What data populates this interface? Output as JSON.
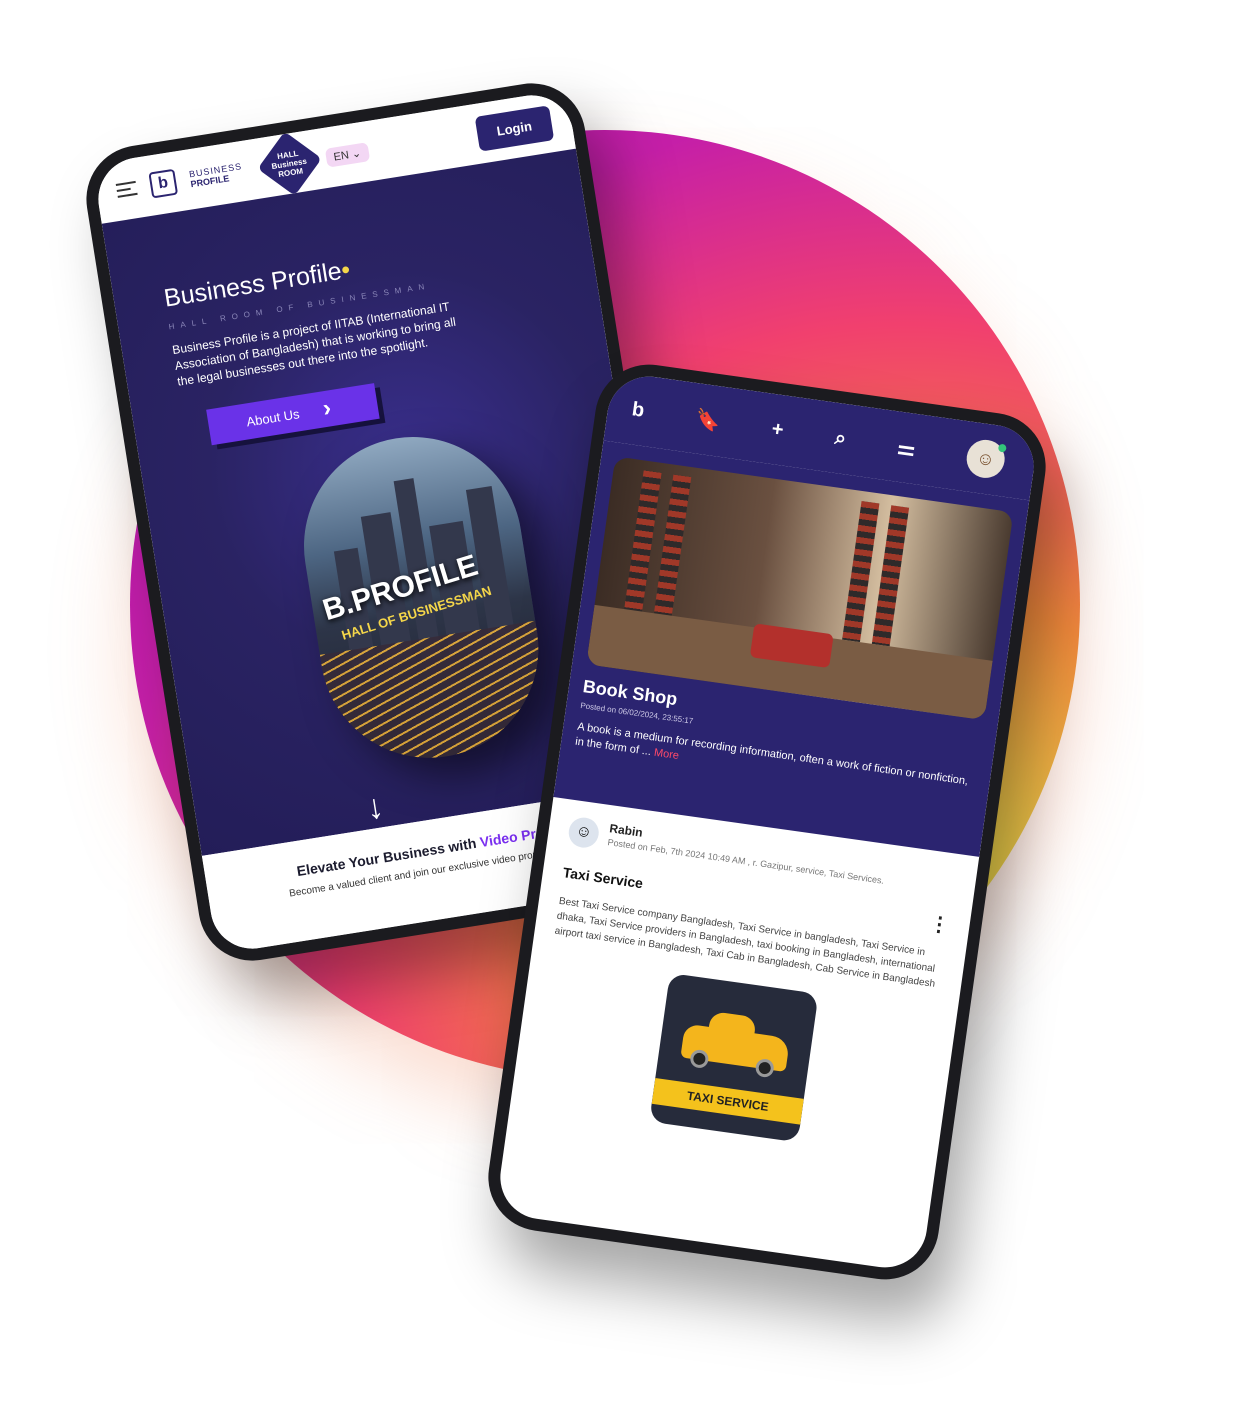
{
  "phone1": {
    "brand_short": "b",
    "brand_line1": "BUSINESS",
    "brand_line2": "PROFILE",
    "hall_badge": "HALL\nBusiness\nROOM",
    "lang": "EN",
    "login_label": "Login",
    "hero": {
      "title": "Business Profile",
      "subtitle": "HALL ROOM OF BUSINESSMAN",
      "description": "Business Profile is a project of IITAB (International IT Association of Bangladesh) that is working to bring all the legal businesses out there into the spotlight.",
      "about_label": "About Us",
      "pill_title": "B.PROFILE",
      "pill_subtitle": "HALL OF BUSINESSMAN"
    },
    "promo": {
      "title_prefix": "Elevate Your Business with ",
      "title_highlight": "Video Promotion",
      "description": "Become a valued client and join our exclusive video promotion program."
    }
  },
  "phone2": {
    "nav_icons": [
      "brand-b-icon",
      "bookmark-icon",
      "plus-icon",
      "search-icon",
      "filter-sliders-icon",
      "avatar"
    ],
    "card": {
      "title": "Book Shop",
      "date": "Posted on 06/02/2024, 23:55:17",
      "description": "A book is a medium for recording information, often a work of fiction or nonfiction, in the form of ...",
      "more": "More"
    },
    "post": {
      "author": "Rabin",
      "meta": "Posted on Feb, 7th 2024 10:49 AM , r. Gazipur, service, Taxi Services.",
      "title": "Taxi Service",
      "description": "Best Taxi Service company Bangladesh, Taxi Service in bangladesh, Taxi Service in dhaka, Taxi Service providers in Bangladesh, taxi booking in Bangladesh, international airport taxi service in Bangladesh, Taxi Cab in Bangladesh, Cab Service in Bangladesh",
      "image_label": "TAXI SERVICE"
    }
  },
  "colors": {
    "primary": "#2b2470",
    "accent": "#6a32e8",
    "highlight": "#7a2ff0",
    "gradient": [
      "#b015b8",
      "#f1406e",
      "#f28a3c",
      "#e5ea4e"
    ]
  }
}
